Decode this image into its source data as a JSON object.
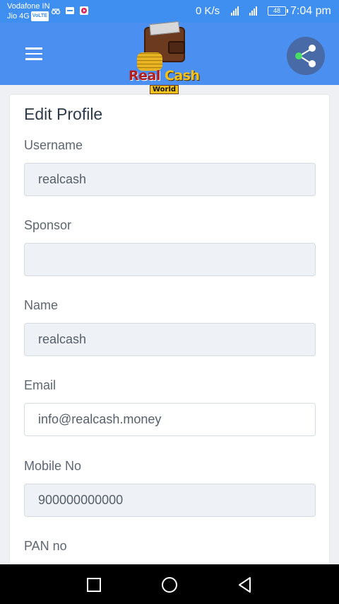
{
  "status_bar": {
    "carrier_1": "Vodafone IN",
    "carrier_2": "Jio 4G",
    "lte_badge": "VoLTE",
    "network_speed": "0 K/s",
    "battery": "48",
    "time": "7:04 pm"
  },
  "app_bar": {
    "logo_text_1": "Real",
    "logo_text_2": "Cash",
    "logo_sub": "World"
  },
  "form": {
    "title": "Edit Profile",
    "fields": [
      {
        "label": "Username",
        "value": "realcash",
        "placeholder": ""
      },
      {
        "label": "Sponsor",
        "value": "",
        "placeholder": ""
      },
      {
        "label": "Name",
        "value": "realcash",
        "placeholder": ""
      },
      {
        "label": "Email",
        "value": "info@realcash.money",
        "placeholder": ""
      },
      {
        "label": "Mobile No",
        "value": "900000000000",
        "placeholder": ""
      },
      {
        "label": "PAN no",
        "value": "",
        "placeholder": ""
      }
    ]
  },
  "colors": {
    "app_bar": "#4b8ff0",
    "share_button": "#486aa6",
    "share_icon_accent": "#4ade66"
  },
  "icons": {
    "menu": "hamburger-icon",
    "share": "share-icon",
    "nav_recent": "square-icon",
    "nav_home": "circle-icon",
    "nav_back": "triangle-back-icon"
  }
}
